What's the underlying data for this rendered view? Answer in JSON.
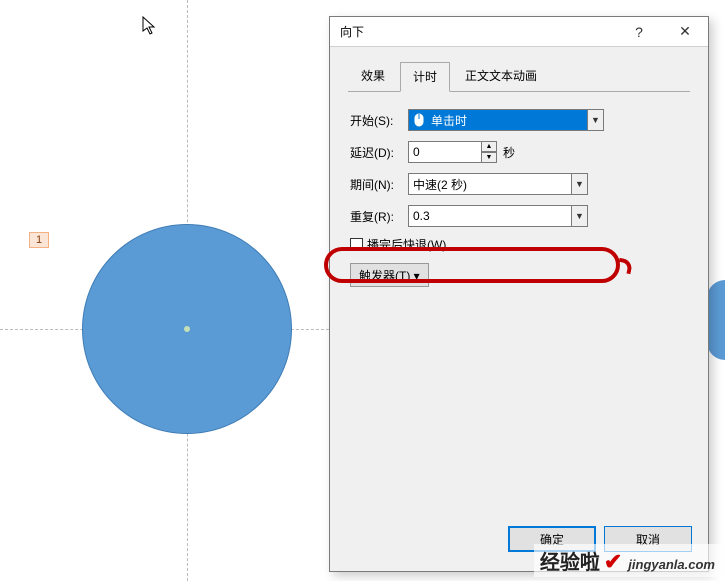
{
  "canvas": {
    "seq_badge": "1"
  },
  "dialog": {
    "title": "向下",
    "help_label": "?",
    "close_label": "✕",
    "tabs": {
      "effect": "效果",
      "timing": "计时",
      "text_anim": "正文文本动画"
    },
    "form": {
      "start_label": "开始(S):",
      "start_value": "单击时",
      "start_icon": "mouse-icon",
      "delay_label": "延迟(D):",
      "delay_value": "0",
      "delay_unit": "秒",
      "duration_label": "期间(N):",
      "duration_value": "中速(2 秒)",
      "repeat_label": "重复(R):",
      "repeat_value": "0.3",
      "rewind_label": "播完后快退(W)",
      "trigger_label": "触发器(T) ▾"
    },
    "footer": {
      "ok": "确定",
      "cancel": "取消"
    }
  },
  "watermark": {
    "brand": "经验啦",
    "site": "jingyanla.com"
  }
}
